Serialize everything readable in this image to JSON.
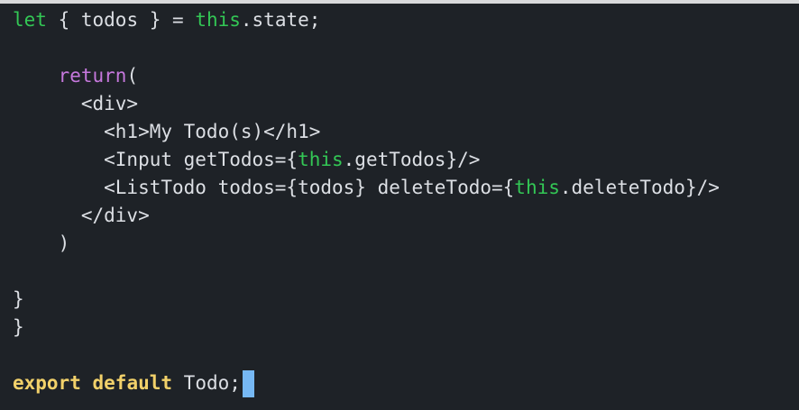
{
  "editor": {
    "colors": {
      "background": "#1e2227",
      "text": "#dcdfe4",
      "keyword_green": "#33c755",
      "keyword_purple": "#c678dd",
      "keyword_yellow": "#f2d16a",
      "cursor": "#76b8f4"
    },
    "lines": [
      {
        "segments": [
          {
            "text": "let",
            "style": "kw-green"
          },
          {
            "text": " { todos } = ",
            "style": "plain"
          },
          {
            "text": "this",
            "style": "kw-green"
          },
          {
            "text": ".state;",
            "style": "plain"
          }
        ]
      },
      {
        "segments": []
      },
      {
        "segments": [
          {
            "text": "    ",
            "style": "plain"
          },
          {
            "text": "return",
            "style": "kw-purple"
          },
          {
            "text": "(",
            "style": "plain"
          }
        ]
      },
      {
        "segments": [
          {
            "text": "      <div>",
            "style": "plain"
          }
        ]
      },
      {
        "segments": [
          {
            "text": "        <h1>My Todo(s)</h1>",
            "style": "plain"
          }
        ]
      },
      {
        "segments": [
          {
            "text": "        <Input getTodos={",
            "style": "plain"
          },
          {
            "text": "this",
            "style": "kw-green"
          },
          {
            "text": ".getTodos}/>",
            "style": "plain"
          }
        ]
      },
      {
        "segments": [
          {
            "text": "        <ListTodo todos={todos} deleteTodo={",
            "style": "plain"
          },
          {
            "text": "this",
            "style": "kw-green"
          },
          {
            "text": ".deleteTodo}/>",
            "style": "plain"
          }
        ]
      },
      {
        "segments": [
          {
            "text": "      </div>",
            "style": "plain"
          }
        ]
      },
      {
        "segments": [
          {
            "text": "    )",
            "style": "plain"
          }
        ]
      },
      {
        "segments": []
      },
      {
        "segments": [
          {
            "text": "}",
            "style": "plain"
          }
        ]
      },
      {
        "segments": [
          {
            "text": "}",
            "style": "plain"
          }
        ]
      },
      {
        "segments": []
      },
      {
        "segments": [
          {
            "text": "export",
            "style": "kw-yellow"
          },
          {
            "text": " ",
            "style": "plain"
          },
          {
            "text": "default",
            "style": "kw-yellow"
          },
          {
            "text": " Todo;",
            "style": "plain"
          }
        ],
        "cursor": true
      }
    ]
  }
}
